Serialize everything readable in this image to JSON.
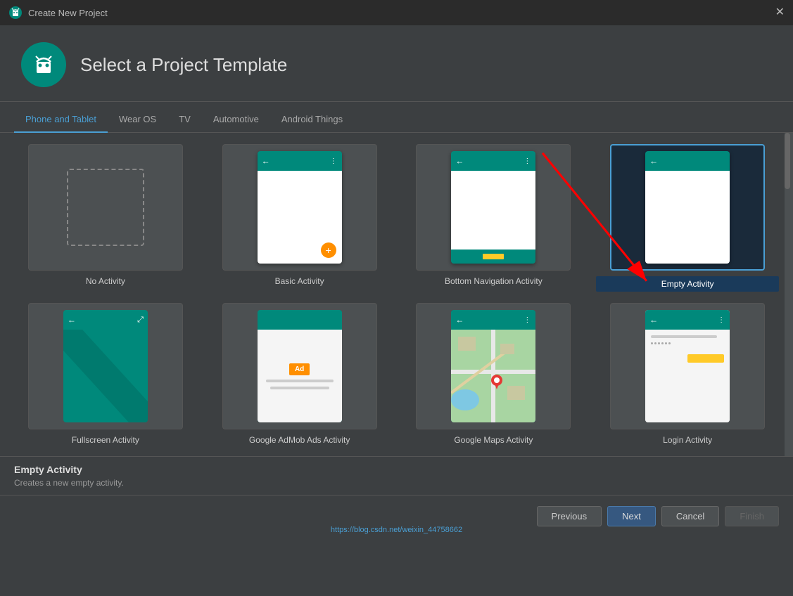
{
  "titleBar": {
    "title": "Create New Project",
    "closeLabel": "✕"
  },
  "header": {
    "title": "Select a Project Template"
  },
  "tabs": [
    {
      "id": "phone-tablet",
      "label": "Phone and Tablet",
      "active": true
    },
    {
      "id": "wear-os",
      "label": "Wear OS",
      "active": false
    },
    {
      "id": "tv",
      "label": "TV",
      "active": false
    },
    {
      "id": "automotive",
      "label": "Automotive",
      "active": false
    },
    {
      "id": "android-things",
      "label": "Android Things",
      "active": false
    }
  ],
  "templates": {
    "row1": [
      {
        "id": "no-activity",
        "label": "No Activity",
        "selected": false
      },
      {
        "id": "basic-activity",
        "label": "Basic Activity",
        "selected": false
      },
      {
        "id": "bottom-nav",
        "label": "Bottom Navigation Activity",
        "selected": false
      },
      {
        "id": "empty-activity",
        "label": "Empty Activity",
        "selected": true
      }
    ],
    "row2": [
      {
        "id": "fullscreen",
        "label": "Fullscreen Activity",
        "selected": false
      },
      {
        "id": "google-admob",
        "label": "Google AdMob Ads Activity",
        "selected": false
      },
      {
        "id": "google-maps",
        "label": "Google Maps Activity",
        "selected": false
      },
      {
        "id": "login",
        "label": "Login Activity",
        "selected": false
      }
    ]
  },
  "bottomInfo": {
    "title": "Empty Activity",
    "description": "Creates a new empty activity."
  },
  "footer": {
    "previousLabel": "Previous",
    "nextLabel": "Next",
    "cancelLabel": "Cancel",
    "finishLabel": "Finish",
    "link": "https://blog.csdn.net/weixin_44758662"
  }
}
